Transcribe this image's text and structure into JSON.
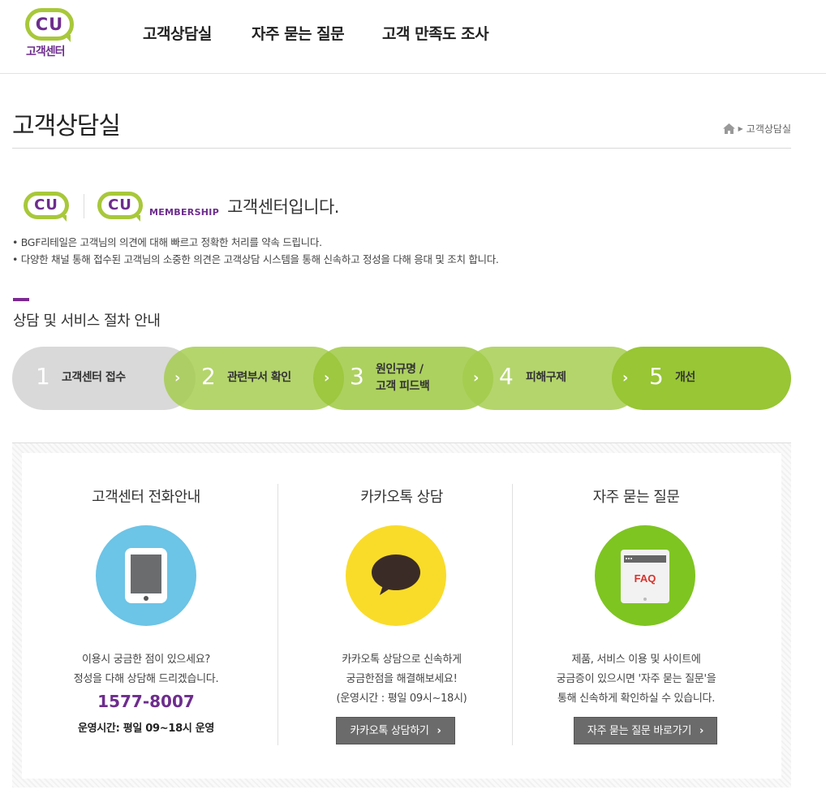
{
  "header": {
    "logo_text": "CU",
    "logo_sub": "고객센터",
    "nav": [
      "고객상담실",
      "자주 묻는 질문",
      "고객 만족도 조사"
    ]
  },
  "page": {
    "title": "고객상담실",
    "breadcrumb_current": "고객상담실"
  },
  "intro": {
    "logo1": "CU",
    "logo2": "CU",
    "membership": "MEMBERSHIP",
    "heading": "고객센터입니다.",
    "bullets": [
      "• BGF리테일은 고객님의 의견에 대해 빠르고 정확한 처리를 약속 드립니다.",
      "• 다양한 채널 통해 접수된 고객님의 소중한 의견은 고객상담 시스템을 통해 신속하고 정성을 다해 응대 및 조치 합니다."
    ]
  },
  "steps_section": {
    "title": "상담 및 서비스 절차 안내",
    "steps": [
      {
        "num": "1",
        "line1": "고객센터 접수",
        "line2": ""
      },
      {
        "num": "2",
        "line1": "관련부서 확인",
        "line2": ""
      },
      {
        "num": "3",
        "line1": "원인규명 /",
        "line2": "고객 피드백"
      },
      {
        "num": "4",
        "line1": "피해구제",
        "line2": ""
      },
      {
        "num": "5",
        "line1": "개선",
        "line2": ""
      }
    ],
    "chevron": "›",
    "colors": [
      "#d9d9d9",
      "#b6d46a",
      "#a8cc52",
      "#b2d364",
      "#98c634"
    ]
  },
  "cards": {
    "phone": {
      "title": "고객센터 전화안내",
      "desc1": "이용시 궁금한 점이 있으세요?",
      "desc2": "정성을 다해 상담해 드리겠습니다.",
      "number": "1577-8007",
      "hours": "운영시간: 평일 09~18시 운영",
      "icon": "phone-icon",
      "color": "#6cc4e6"
    },
    "kakao": {
      "title": "카카오톡 상담",
      "desc1": "카카오톡 상담으로 신속하게",
      "desc2": "궁금한점을 해결해보세요!",
      "desc3": "(운영시간 : 평일 09시~18시)",
      "button": "카카오톡 상담하기",
      "icon": "speech-bubble-icon",
      "color": "#f9dc2a"
    },
    "faq": {
      "title": "자주 묻는 질문",
      "desc1": "제품, 서비스 이용 및 사이트에",
      "desc2": "궁금증이 있으시면 '자주 묻는 질문'을",
      "desc3": "통해 신속하게 확인하실 수 있습니다.",
      "button": "자주 묻는 질문 바로가기",
      "icon_text": "FAQ",
      "icon": "faq-icon",
      "color": "#7ec521"
    },
    "button_arrow": "›"
  }
}
